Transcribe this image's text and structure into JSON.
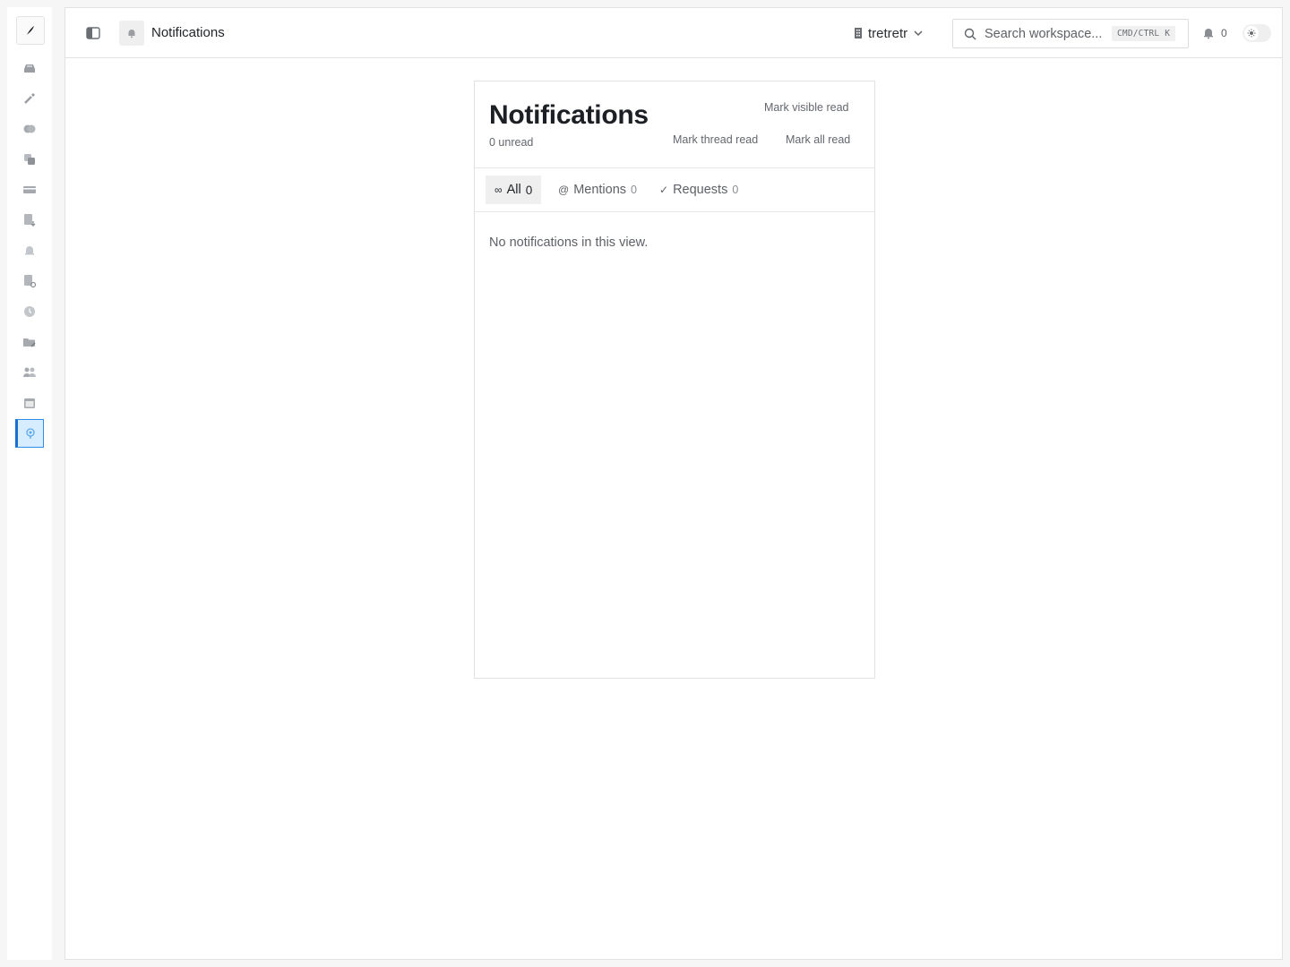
{
  "header": {
    "page_title": "Notifications",
    "workspace_name": "tretretr",
    "search_placeholder": "Search workspace...",
    "search_shortcut": "CMD/CTRL K",
    "notification_count": "0"
  },
  "sidebar": {
    "items": [
      {
        "icon": "inbox-icon"
      },
      {
        "icon": "magic-wand-icon"
      },
      {
        "icon": "brain-icon"
      },
      {
        "icon": "copy-icon"
      },
      {
        "icon": "card-icon"
      },
      {
        "icon": "document-download-icon"
      },
      {
        "icon": "bell-icon"
      },
      {
        "icon": "document-refresh-icon"
      },
      {
        "icon": "clock-icon"
      },
      {
        "icon": "folder-edit-icon"
      },
      {
        "icon": "people-icon"
      },
      {
        "icon": "calendar-icon"
      },
      {
        "icon": "settings-icon",
        "active": true
      }
    ]
  },
  "panel": {
    "title": "Notifications",
    "unread_text": "0 unread",
    "mark_visible_read": "Mark visible read",
    "mark_thread_read": "Mark thread read",
    "mark_all_read": "Mark all read",
    "tabs": [
      {
        "glyph": "∞",
        "label": "All",
        "count": "0",
        "active": true
      },
      {
        "glyph": "@",
        "label": "Mentions",
        "count": "0"
      },
      {
        "glyph": "✓",
        "label": "Requests",
        "count": "0"
      }
    ],
    "empty_message": "No notifications in this view."
  },
  "colors": {
    "accent": "#2f8ee6",
    "active_bg": "#d6ecff"
  }
}
